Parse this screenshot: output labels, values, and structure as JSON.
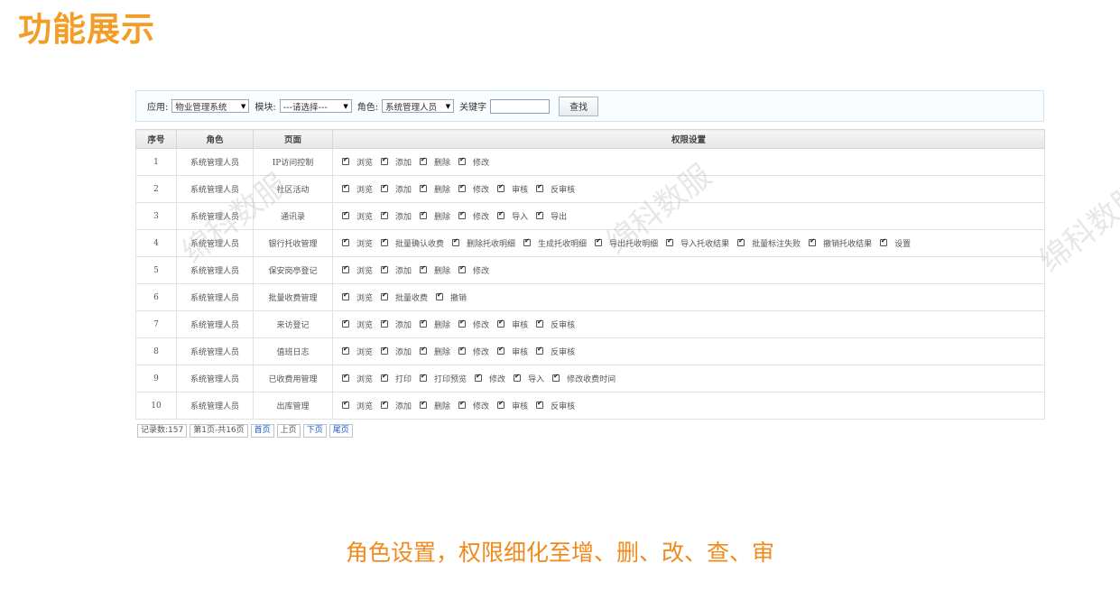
{
  "header": {
    "title": "功能展示"
  },
  "filters": {
    "app_label": "应用:",
    "app_value": "物业管理系统",
    "module_label": "模块:",
    "module_value": "---请选择---",
    "role_label": "角色:",
    "role_value": "系统管理人员",
    "keyword_label": "关键字",
    "keyword_value": "",
    "find_button": "查找"
  },
  "table": {
    "columns": [
      "序号",
      "角色",
      "页面",
      "权限设置"
    ],
    "rows": [
      {
        "no": "1",
        "role": "系统管理人员",
        "page": "IP访问控制",
        "perms": [
          "浏览",
          "添加",
          "删除",
          "修改"
        ]
      },
      {
        "no": "2",
        "role": "系统管理人员",
        "page": "社区活动",
        "perms": [
          "浏览",
          "添加",
          "删除",
          "修改",
          "审核",
          "反审核"
        ]
      },
      {
        "no": "3",
        "role": "系统管理人员",
        "page": "通讯录",
        "perms": [
          "浏览",
          "添加",
          "删除",
          "修改",
          "导入",
          "导出"
        ]
      },
      {
        "no": "4",
        "role": "系统管理人员",
        "page": "银行托收管理",
        "perms": [
          "浏览",
          "批量确认收费",
          "删除托收明细",
          "生成托收明细",
          "导出托收明细",
          "导入托收结果",
          "批量标注失败",
          "撤销托收结果",
          "设置"
        ]
      },
      {
        "no": "5",
        "role": "系统管理人员",
        "page": "保安岗亭登记",
        "perms": [
          "浏览",
          "添加",
          "删除",
          "修改"
        ]
      },
      {
        "no": "6",
        "role": "系统管理人员",
        "page": "批量收费管理",
        "perms": [
          "浏览",
          "批量收费",
          "撤销"
        ]
      },
      {
        "no": "7",
        "role": "系统管理人员",
        "page": "来访登记",
        "perms": [
          "浏览",
          "添加",
          "删除",
          "修改",
          "审核",
          "反审核"
        ]
      },
      {
        "no": "8",
        "role": "系统管理人员",
        "page": "值班日志",
        "perms": [
          "浏览",
          "添加",
          "删除",
          "修改",
          "审核",
          "反审核"
        ]
      },
      {
        "no": "9",
        "role": "系统管理人员",
        "page": "已收费用管理",
        "perms": [
          "浏览",
          "打印",
          "打印预览",
          "修改",
          "导入",
          "修改收费时间"
        ]
      },
      {
        "no": "10",
        "role": "系统管理人员",
        "page": "出库管理",
        "perms": [
          "浏览",
          "添加",
          "删除",
          "修改",
          "审核",
          "反审核"
        ]
      }
    ]
  },
  "pager": {
    "records": "记录数:157",
    "page_info": "第1页-共16页",
    "first": "首页",
    "prev": "上页",
    "next": "下页",
    "last": "尾页"
  },
  "caption": "角色设置，权限细化至增、删、改、查、审",
  "watermark": "绵科数服",
  "colors": {
    "title": "#f39d27",
    "caption": "#f08a1c",
    "link": "#1a55c8"
  }
}
